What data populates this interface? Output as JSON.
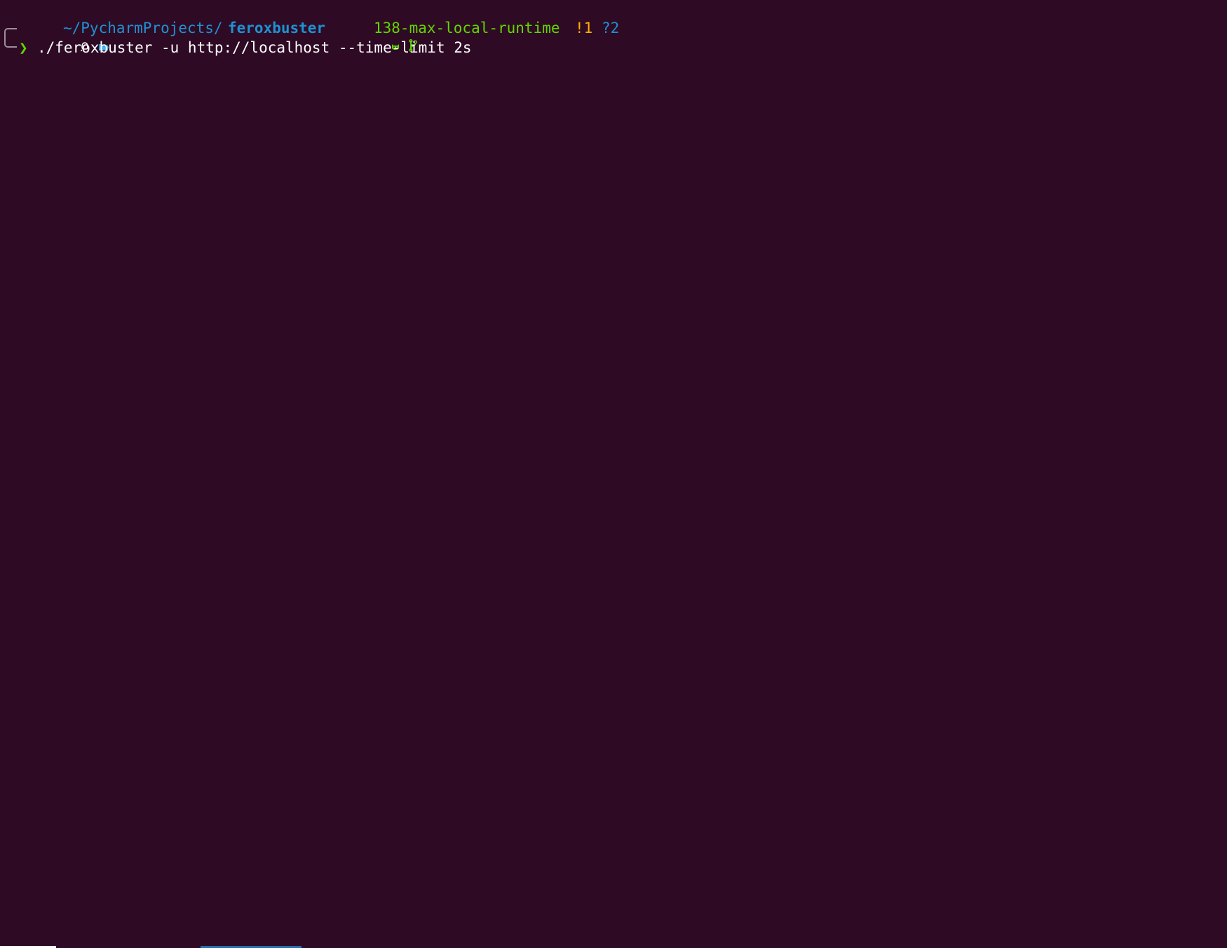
{
  "terminal": {
    "background": "#2f0a24",
    "prompt": {
      "path_prefix": "~/PycharmProjects/",
      "path_dir": "feroxbuster",
      "branch": "138-max-local-runtime",
      "modified_count": "!1",
      "untracked_count": "?2",
      "icons": [
        "linux-icon",
        "folder-icon",
        "github-icon",
        "git-branch-icon",
        "prompt-chevron-icon"
      ],
      "colors": {
        "path": "#1e92d2",
        "branch": "#5fd700",
        "modified": "#ffaf00",
        "untracked": "#1e92d2",
        "chevron": "#5fd700",
        "bracket": "#9a8f99"
      }
    },
    "command": "./feroxbuster -u http://localhost --time-limit 2s",
    "text_color": "#ffffff"
  },
  "taskbar": {
    "item_colors": [
      "#ffffff",
      "#2a6fa8"
    ]
  }
}
